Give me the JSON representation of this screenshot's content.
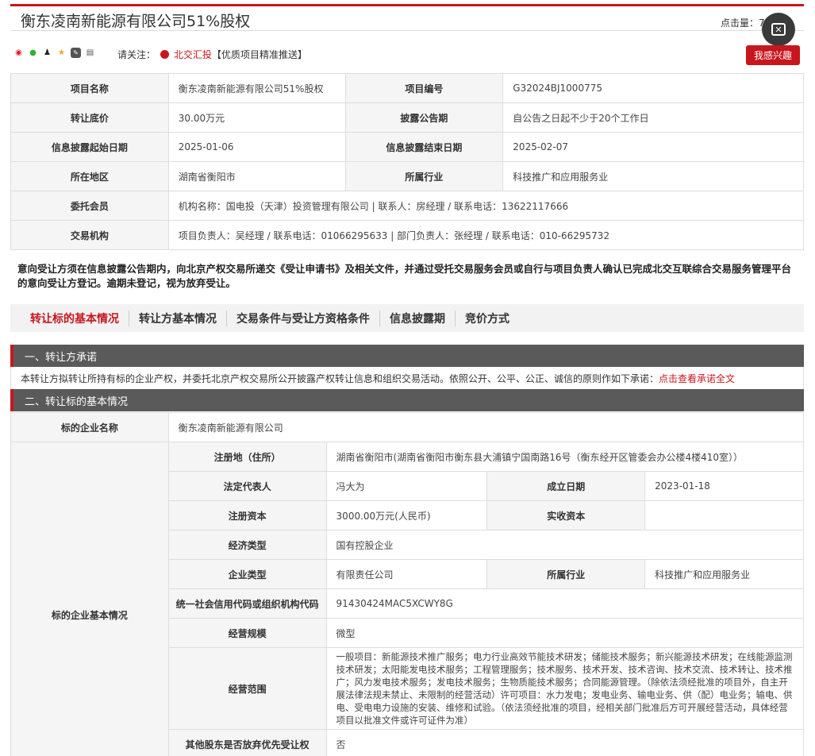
{
  "header": {
    "title": "衡东凌南新能源有限公司51%股权",
    "clicks_label": "点击量：7"
  },
  "share": {
    "icons": [
      "weibo-icon",
      "wechat-icon",
      "qq-icon",
      "favorite-icon",
      "qzone-icon",
      "print-icon"
    ],
    "follow_label": "请关注：",
    "follow_brand": "北交汇投",
    "follow_suffix": "【优质项目精准推送】"
  },
  "interest_button": "我感兴趣",
  "overview": {
    "rows": [
      {
        "l1": "项目名称",
        "v1": "衡东凌南新能源有限公司51%股权",
        "l2": "项目编号",
        "v2": "G32024BJ1000775"
      },
      {
        "l1": "转让底价",
        "v1": "30.00万元",
        "l2": "披露公告期",
        "v2": "自公告之日起不少于20个工作日"
      },
      {
        "l1": "信息披露起始日期",
        "v1": "2025-01-06",
        "l2": "信息披露结束日期",
        "v2": "2025-02-07"
      },
      {
        "l1": "所在地区",
        "v1": "湖南省衡阳市",
        "l2": "所属行业",
        "v2": "科技推广和应用服务业"
      }
    ],
    "member_label": "委托会员",
    "member_value": "机构名称：国电投（天津）投资管理有限公司 | 联系人：房经理 / 联系电话：13622117666",
    "agency_label": "交易机构",
    "agency_value": "项目负责人：吴经理 / 联系电话：01066295633 | 部门负责人：张经理 / 联系电话：010-66295732"
  },
  "notice": "意向受让方须在信息披露公告期内，向北京产权交易所递交《受让申请书》及相关文件，并通过受托交易服务会员或自行与项目负责人确认已完成北交互联综合交易服务管理平台的意向受让方登记。逾期未登记，视为放弃受让。",
  "tabs": [
    "转让标的基本情况",
    "转让方基本情况",
    "交易条件与受让方资格条件",
    "信息披露期",
    "竞价方式"
  ],
  "section1": {
    "title": "一、转让方承诺",
    "text": "本转让方拟转让所持有标的企业产权，并委托北京产权交易所公开披露产权转让信息和组织交易活动。依照公开、公平、公正、诚信的原则作如下承诺：",
    "link": "点击查看承诺全文"
  },
  "section2": {
    "title": "二、转让标的基本情况",
    "company_label": "标的企业名称",
    "company_value": "衡东凌南新能源有限公司",
    "group_label": "标的企业基本情况",
    "reg_addr_label": "注册地（住所）",
    "reg_addr_value": "湖南省衡阳市(湖南省衡阳市衡东县大浦镇宁国南路16号（衡东经开区管委会办公楼4楼410室））",
    "legal_rep_label": "法定代表人",
    "legal_rep_value": "冯大为",
    "est_date_label": "成立日期",
    "est_date_value": "2023-01-18",
    "reg_cap_label": "注册资本",
    "reg_cap_value": "3000.00万元(人民币)",
    "paid_cap_label": "实收资本",
    "paid_cap_value": "",
    "econ_type_label": "经济类型",
    "econ_type_value": "国有控股企业",
    "ent_type_label": "企业类型",
    "ent_type_value": "有限责任公司",
    "industry_label": "所属行业",
    "industry_value": "科技推广和应用服务业",
    "credit_label": "统一社会信用代码或组织机构代码",
    "credit_value": "91430424MAC5XCWY8G",
    "scale_label": "经营规模",
    "scale_value": "微型",
    "scope_label": "经营范围",
    "scope_value": "一般项目：新能源技术推广服务；电力行业高效节能技术研发；储能技术服务；新兴能源技术研发；在线能源监测技术研发；太阳能发电技术服务；工程管理服务；技术服务、技术开发、技术咨询、技术交流、技术转让、技术推广；风力发电技术服务；发电技术服务；生物质能技术服务；合同能源管理。（除依法须经批准的项目外，自主开展法律法规未禁止、未限制的经营活动）许可项目：水力发电；发电业务、输电业务、供（配）电业务；输电、供电、受电电力设施的安装、维修和试验。（依法须经批准的项目，经相关部门批准后方可开展经营活动，具体经营项目以批准文件或许可证件为准）",
    "other_holders_label": "其他股东是否放弃优先受让权",
    "other_holders_value": "否"
  }
}
